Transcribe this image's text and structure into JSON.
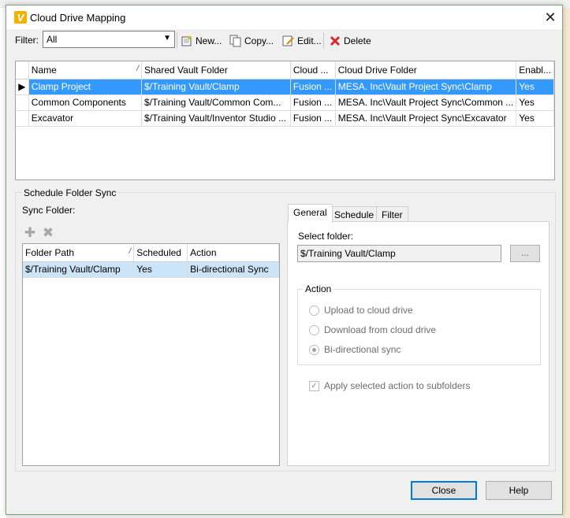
{
  "dialog": {
    "title": "Cloud Drive Mapping",
    "app_icon_letter": "V",
    "close_glyph": "✕"
  },
  "toolbar": {
    "filter_label": "Filter:",
    "filter_value": "All",
    "new_label": "New...",
    "copy_label": "Copy...",
    "edit_label": "Edit...",
    "delete_label": "Delete"
  },
  "mappings": {
    "columns": [
      "Name",
      "Shared Vault Folder",
      "Cloud ...",
      "Cloud Drive Folder",
      "Enabl..."
    ],
    "rows": [
      {
        "name": "Clamp Project",
        "vault_folder": "$/Training Vault/Clamp",
        "cloud": "Fusion ...",
        "cloud_folder": "MESA. Inc\\Vault Project Sync\\Clamp",
        "enabled": "Yes"
      },
      {
        "name": "Common Components",
        "vault_folder": "$/Training Vault/Common Com...",
        "cloud": "Fusion ...",
        "cloud_folder": "MESA. Inc\\Vault Project Sync\\Common ...",
        "enabled": "Yes"
      },
      {
        "name": "Excavator",
        "vault_folder": "$/Training Vault/Inventor Studio ...",
        "cloud": "Fusion ...",
        "cloud_folder": "MESA. Inc\\Vault Project Sync\\Excavator",
        "enabled": "Yes"
      }
    ]
  },
  "schedule": {
    "group_title": "Schedule Folder Sync",
    "sync_folder_label": "Sync Folder:",
    "columns": [
      "Folder Path",
      "Scheduled",
      "Action"
    ],
    "rows": [
      {
        "folder_path": "$/Training Vault/Clamp",
        "scheduled": "Yes",
        "action": "Bi-directional Sync"
      }
    ]
  },
  "tabs": {
    "items": [
      "General",
      "Schedule",
      "Filter"
    ],
    "active": "General"
  },
  "general": {
    "select_folder_label": "Select folder:",
    "folder_value": "$/Training Vault/Clamp",
    "browse_label": "...",
    "action_title": "Action",
    "options": [
      "Upload to cloud drive",
      "Download from cloud drive",
      "Bi-directional sync"
    ],
    "selected_option": "Bi-directional sync",
    "apply_subfolders_label": "Apply selected action to subfolders"
  },
  "buttons": {
    "close_label": "Close",
    "help_label": "Help"
  },
  "colors": {
    "selection": "#3399ff",
    "default_button_border": "#0078d7",
    "app_icon": "#f2b300"
  }
}
